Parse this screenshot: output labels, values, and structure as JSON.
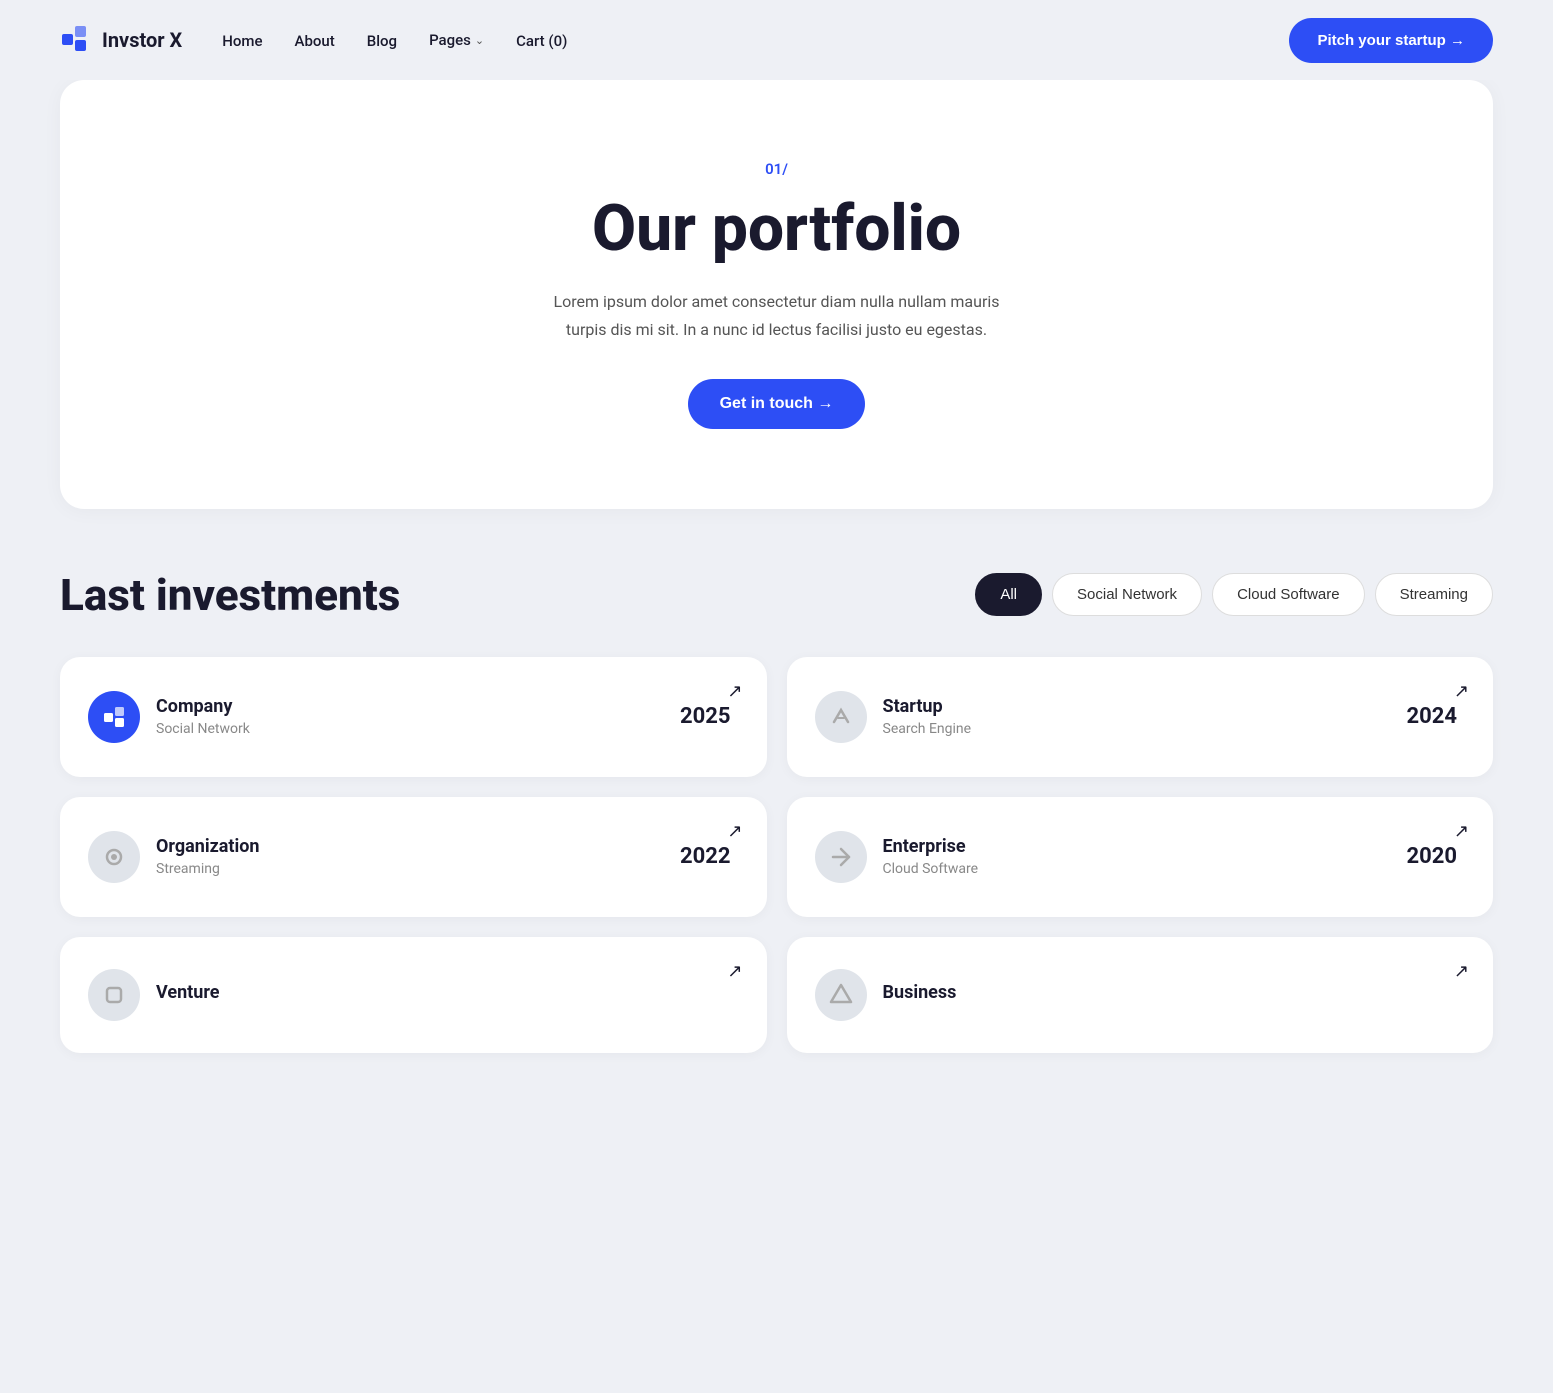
{
  "brand": {
    "name": "Invstor X",
    "logo_icon": "◆"
  },
  "navbar": {
    "links": [
      {
        "label": "Home",
        "id": "home"
      },
      {
        "label": "About",
        "id": "about"
      },
      {
        "label": "Blog",
        "id": "blog"
      },
      {
        "label": "Pages",
        "id": "pages",
        "has_dropdown": true
      },
      {
        "label": "Cart (0)",
        "id": "cart"
      }
    ],
    "cta_label": "Pitch your startup →"
  },
  "hero": {
    "label": "01/",
    "title": "Our portfolio",
    "description": "Lorem ipsum dolor amet consectetur diam nulla nullam mauris turpis dis mi sit. In a nunc id lectus facilisi justo eu egestas.",
    "cta_label": "Get in touch →"
  },
  "investments": {
    "section_title": "Last investments",
    "filters": [
      {
        "label": "All",
        "active": true
      },
      {
        "label": "Social Network",
        "active": false
      },
      {
        "label": "Cloud Software",
        "active": false
      },
      {
        "label": "Streaming",
        "active": false
      }
    ],
    "cards": [
      {
        "name": "Company",
        "category": "Social Network",
        "year": "2025",
        "logo_type": "blue",
        "logo_symbol": "▣"
      },
      {
        "name": "Startup",
        "category": "Search Engine",
        "year": "2024",
        "logo_type": "gray",
        "logo_symbol": "↗"
      },
      {
        "name": "Organization",
        "category": "Streaming",
        "year": "2022",
        "logo_type": "gray",
        "logo_symbol": "◉"
      },
      {
        "name": "Enterprise",
        "category": "Cloud Software",
        "year": "2020",
        "logo_type": "gray",
        "logo_symbol": "⇄"
      },
      {
        "name": "Venture",
        "category": "",
        "year": "",
        "logo_type": "gray",
        "logo_symbol": "◈"
      },
      {
        "name": "Business",
        "category": "",
        "year": "",
        "logo_type": "gray",
        "logo_symbol": "◆"
      }
    ]
  },
  "icons": {
    "arrow_up_right": "↗",
    "chevron_down": "⌄",
    "arrow_right": "→"
  }
}
